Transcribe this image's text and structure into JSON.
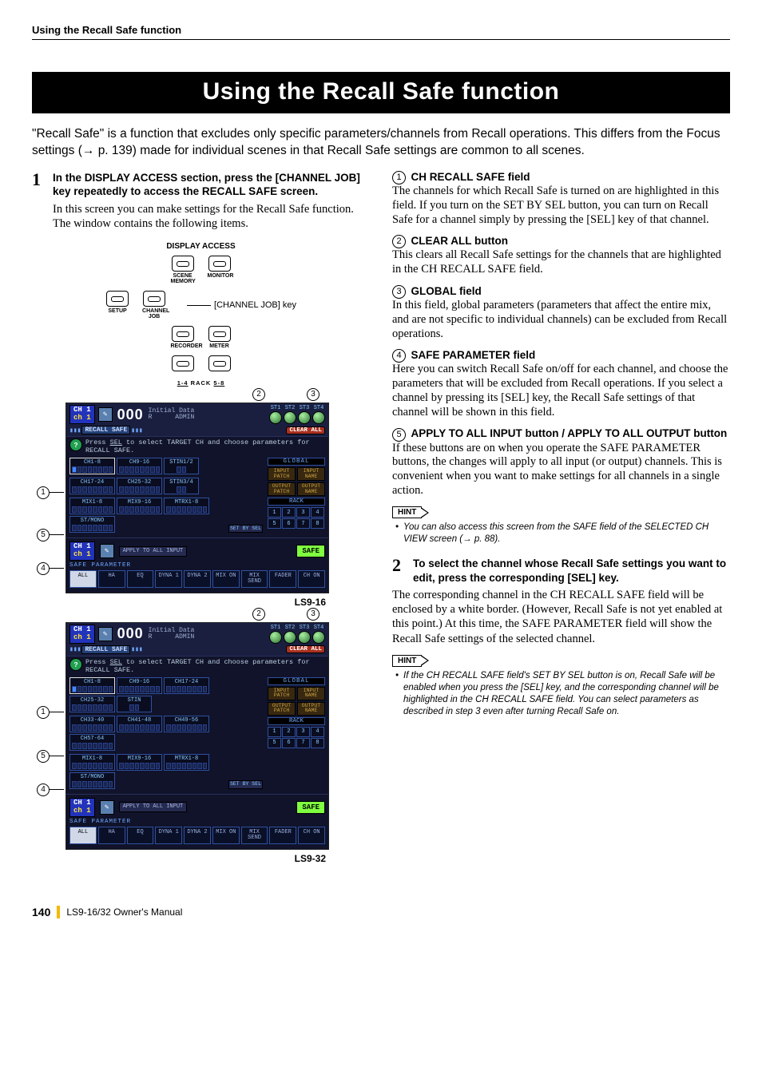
{
  "running_head": "Using the Recall Safe function",
  "title": "Using the Recall Safe function",
  "intro": "\"Recall Safe\" is a function that excludes only specific parameters/channels from Recall operations. This differs from the Focus settings (→ p. 139) made for individual scenes in that Recall Safe settings are common to all scenes.",
  "step1": {
    "num": "1",
    "head": "In the DISPLAY ACCESS section, press the [CHANNEL JOB] key repeatedly to access the RECALL SAFE screen.",
    "body": "In this screen you can make settings for the Recall Safe function. The window contains the following items."
  },
  "display_access": {
    "title": "DISPLAY ACCESS",
    "row1": [
      {
        "top": "SCENE",
        "bot": "MEMORY"
      },
      {
        "top": "MONITOR",
        "bot": ""
      }
    ],
    "row2": [
      {
        "top": "SETUP",
        "bot": ""
      },
      {
        "top": "CHANNEL",
        "bot": "JOB"
      }
    ],
    "row2_callout": "[CHANNEL JOB] key",
    "row3": [
      {
        "top": "RECORDER",
        "bot": ""
      },
      {
        "top": "METER",
        "bot": ""
      }
    ],
    "row4": [
      {
        "top": "",
        "bot": ""
      },
      {
        "top": "",
        "bot": ""
      }
    ],
    "rack_left": "1-4",
    "rack_mid": "RACK",
    "rack_right": "5-8"
  },
  "screenshot16": {
    "ch_top": "CH 1",
    "ch_bot": "ch 1",
    "scene": "000",
    "scene_name": "Initial Data",
    "scene_sub": "R",
    "admin": "ADMIN",
    "st": [
      "ST1",
      "ST2",
      "ST3",
      "ST4"
    ],
    "tab": "RECALL SAFE",
    "clear": "CLEAR ALL",
    "hint_a": "Press ",
    "hint_sel": "SEL",
    "hint_b": " to select TARGET CH and choose parameters for RECALL SAFE.",
    "rows": [
      [
        "CH1-8",
        "CH9-16",
        "STIN1/2"
      ],
      [
        "CH17-24",
        "CH25-32",
        "STIN3/4"
      ],
      [
        "MIX1-8",
        "MIX9-16",
        "MTRX1-8",
        "ST/MONO"
      ]
    ],
    "set_by": "SET BY SEL",
    "global": "GLOBAL",
    "gbtns": [
      [
        "INPUT PATCH",
        "INPUT NAME"
      ],
      [
        "OUTPUT PATCH",
        "OUTPUT NAME"
      ]
    ],
    "rack": "RACK",
    "racks": [
      "1",
      "2",
      "3",
      "4",
      "5",
      "6",
      "7",
      "8"
    ],
    "apply": "APPLY TO ALL INPUT",
    "safe": "SAFE",
    "safe_param": "SAFE PARAMETER",
    "params": [
      "ALL",
      "HA",
      "EQ",
      "DYNA 1",
      "DYNA 2",
      "MIX ON",
      "MIX SEND",
      "FADER",
      "CH ON"
    ],
    "caption": "LS9-16"
  },
  "screenshot32": {
    "ch_top": "CH 1",
    "ch_bot": "ch 1",
    "scene": "000",
    "scene_name": "Initial Data",
    "scene_sub": "R",
    "admin": "ADMIN",
    "st": [
      "ST1",
      "ST2",
      "ST3",
      "ST4"
    ],
    "tab": "RECALL SAFE",
    "clear": "CLEAR ALL",
    "hint_a": "Press ",
    "hint_sel": "SEL",
    "hint_b": " to select TARGET CH and choose parameters for RECALL SAFE.",
    "rows": [
      [
        "CH1-8",
        "CH9-16",
        "CH17-24",
        "CH25-32",
        "STIN"
      ],
      [
        "CH33-40",
        "CH41-48",
        "CH49-56",
        "CH57-64"
      ],
      [
        "MIX1-8",
        "MIX9-16",
        "MTRX1-8",
        "ST/MONO"
      ]
    ],
    "set_by": "SET BY SEL",
    "global": "GLOBAL",
    "gbtns": [
      [
        "INPUT PATCH",
        "INPUT NAME"
      ],
      [
        "OUTPUT PATCH",
        "OUTPUT NAME"
      ]
    ],
    "rack": "RACK",
    "racks": [
      "1",
      "2",
      "3",
      "4",
      "5",
      "6",
      "7",
      "8"
    ],
    "apply": "APPLY TO ALL INPUT",
    "safe": "SAFE",
    "safe_param": "SAFE PARAMETER",
    "params": [
      "ALL",
      "HA",
      "EQ",
      "DYNA 1",
      "DYNA 2",
      "MIX ON",
      "MIX SEND",
      "FADER",
      "CH ON"
    ],
    "caption": "LS9-32"
  },
  "fields": {
    "f1": {
      "n": "1",
      "head": "CH RECALL SAFE field",
      "body": "The channels for which Recall Safe is turned on are highlighted in this field. If you turn on the SET BY SEL button, you can turn on Recall Safe for a channel simply by pressing the [SEL] key of that channel."
    },
    "f2": {
      "n": "2",
      "head": "CLEAR ALL button",
      "body": "This clears all Recall Safe settings for the channels that are highlighted in the CH RECALL SAFE field."
    },
    "f3": {
      "n": "3",
      "head": "GLOBAL field",
      "body": "In this field, global parameters (parameters that affect the entire mix, and are not specific to individual channels) can be excluded from Recall operations."
    },
    "f4": {
      "n": "4",
      "head": "SAFE PARAMETER field",
      "body": "Here you can switch Recall Safe on/off for each channel, and choose the parameters that will be excluded from Recall operations. If you select a channel by pressing its [SEL] key, the Recall Safe settings of that channel will be shown in this field."
    },
    "f5": {
      "n": "5",
      "head": "APPLY TO ALL INPUT button / APPLY TO ALL OUTPUT button",
      "body": "If these buttons are on when you operate the SAFE PARAMETER buttons, the changes will apply to all input (or output) channels. This is convenient when you want to make settings for all channels in a single action."
    }
  },
  "hint1": {
    "tag": "HINT",
    "body": "You can also access this screen from the SAFE field of the SELECTED CH VIEW screen (→ p. 88)."
  },
  "step2": {
    "num": "2",
    "head": "To select the channel whose Recall Safe settings you want to edit, press the corresponding [SEL] key.",
    "body": "The corresponding channel in the CH RECALL SAFE field will be enclosed by a white border. (However, Recall Safe is not yet enabled at this point.) At this time, the SAFE PARAMETER field will show the Recall Safe settings of the selected channel."
  },
  "hint2": {
    "tag": "HINT",
    "body": "If the CH RECALL SAFE field's SET BY SEL button is on, Recall Safe will be enabled when you press the [SEL] key, and the corresponding channel will be highlighted in the CH RECALL SAFE field. You can select parameters as described in step 3 even after turning Recall Safe on."
  },
  "footer": {
    "page": "140",
    "book": "LS9-16/32  Owner's Manual"
  }
}
